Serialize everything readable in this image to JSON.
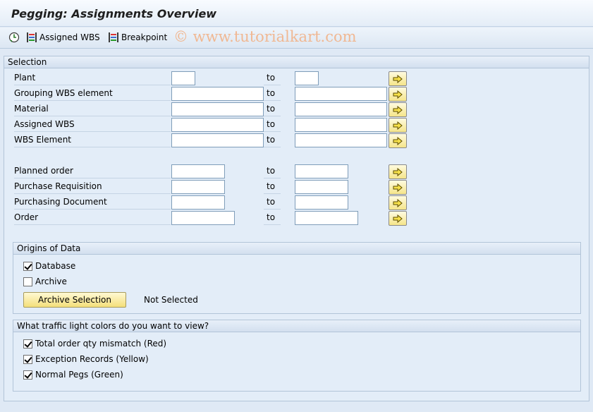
{
  "window": {
    "title": "Pegging: Assignments Overview"
  },
  "toolbar": {
    "items": [
      {
        "icon": "execute-clock-icon",
        "label": ""
      },
      {
        "icon": "assigned-wbs-icon",
        "label": "Assigned WBS"
      },
      {
        "icon": "breakpoint-icon",
        "label": "Breakpoint"
      }
    ],
    "watermark": "© www.tutorialkart.com"
  },
  "selection": {
    "title": "Selection",
    "to_label": "to",
    "rows": [
      {
        "label": "Plant",
        "from": "",
        "to": ""
      },
      {
        "label": "Grouping WBS element",
        "from": "",
        "to": ""
      },
      {
        "label": "Material",
        "from": "",
        "to": ""
      },
      {
        "label": "Assigned WBS",
        "from": "",
        "to": ""
      },
      {
        "label": "WBS Element",
        "from": "",
        "to": ""
      },
      {
        "label": "Planned order",
        "from": "",
        "to": ""
      },
      {
        "label": "Purchase Requisition",
        "from": "",
        "to": ""
      },
      {
        "label": "Purchasing Document",
        "from": "",
        "to": ""
      },
      {
        "label": "Order",
        "from": "",
        "to": ""
      }
    ]
  },
  "origins": {
    "title": "Origins of Data",
    "database": {
      "label": "Database",
      "checked": true
    },
    "archive": {
      "label": "Archive",
      "checked": false
    },
    "archive_button": "Archive Selection",
    "archive_status": "Not Selected"
  },
  "traffic": {
    "title": "What traffic light colors do you want to view?",
    "options": [
      {
        "label": "Total order qty mismatch (Red)",
        "checked": true
      },
      {
        "label": "Exception Records (Yellow)",
        "checked": true
      },
      {
        "label": "Normal Pegs (Green)",
        "checked": true
      }
    ]
  },
  "colors": {
    "background": "#dfe9f5",
    "watermark": "#f0b893",
    "multi_select_button": "#f5e58a"
  }
}
